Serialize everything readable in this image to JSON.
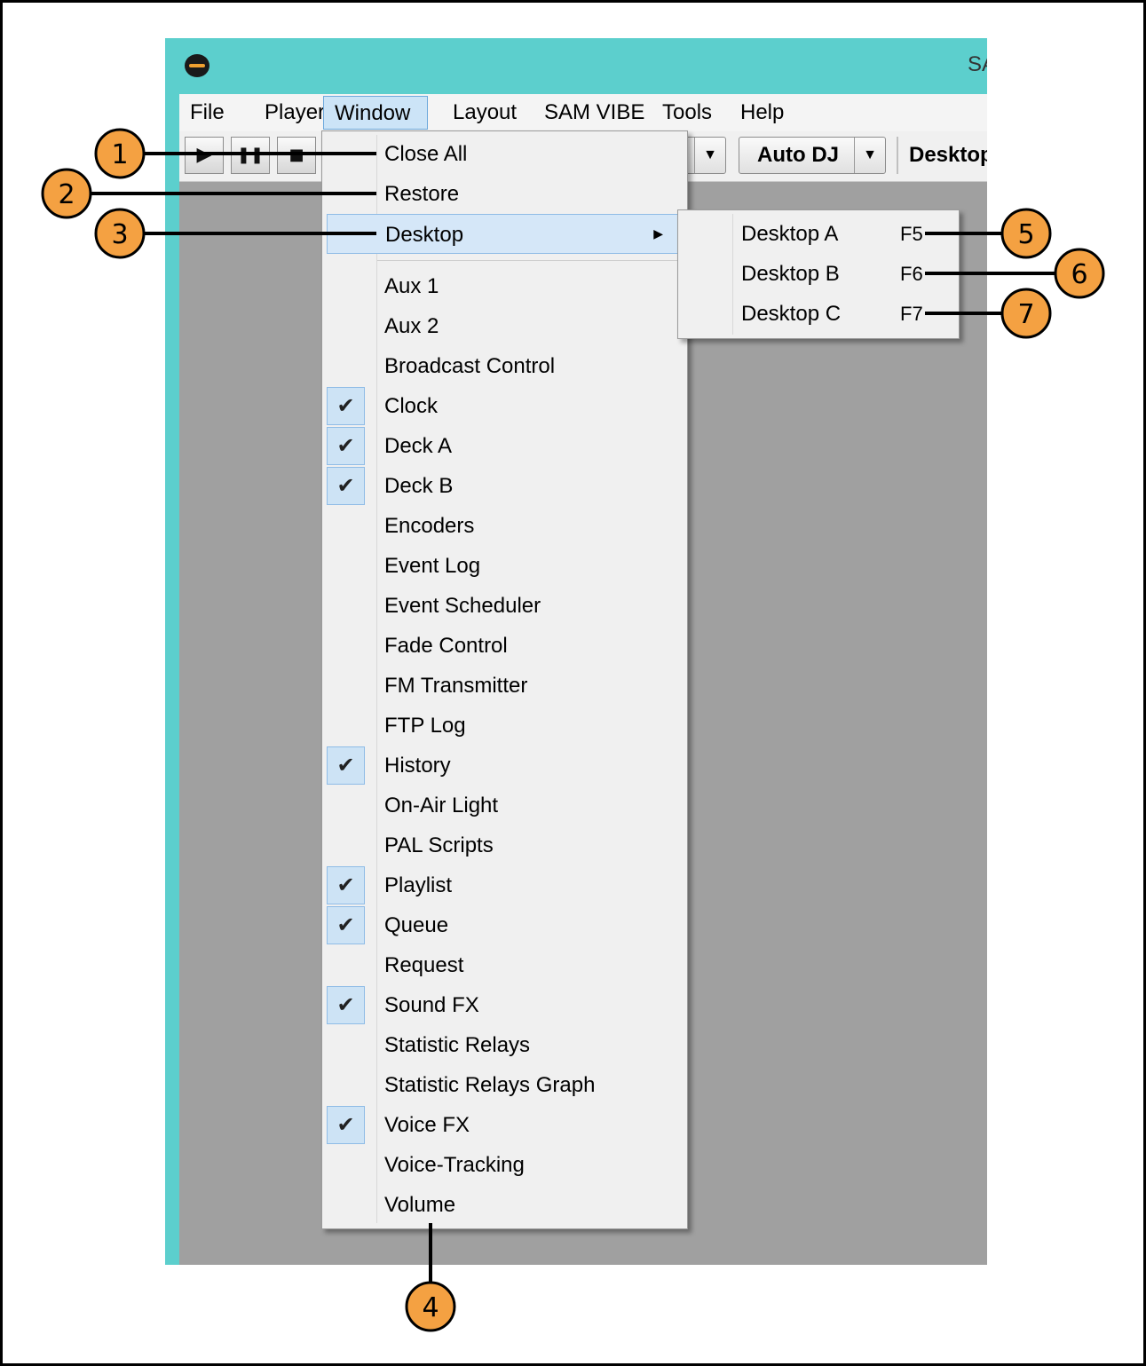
{
  "app": {
    "title": "SA"
  },
  "menubar": {
    "items": [
      "File",
      "Player",
      "Window",
      "Layout",
      "SAM VIBE",
      "Tools",
      "Help"
    ],
    "active": "Window"
  },
  "toolbar": {
    "play_icon": "▶",
    "pause_icon": "❚❚",
    "stop_icon": "■",
    "arrow_icon": "▼",
    "autodj_label": "Auto DJ",
    "desktop_label": "Desktop"
  },
  "window_menu": {
    "top_items": [
      "Close All",
      "Restore",
      "Desktop"
    ],
    "items": [
      {
        "label": "Aux 1",
        "checked": false
      },
      {
        "label": "Aux 2",
        "checked": false
      },
      {
        "label": "Broadcast Control",
        "checked": false
      },
      {
        "label": "Clock",
        "checked": true
      },
      {
        "label": "Deck A",
        "checked": true
      },
      {
        "label": "Deck B",
        "checked": true
      },
      {
        "label": "Encoders",
        "checked": false
      },
      {
        "label": "Event Log",
        "checked": false
      },
      {
        "label": "Event Scheduler",
        "checked": false
      },
      {
        "label": "Fade Control",
        "checked": false
      },
      {
        "label": "FM Transmitter",
        "checked": false
      },
      {
        "label": "FTP Log",
        "checked": false
      },
      {
        "label": "History",
        "checked": true
      },
      {
        "label": "On-Air Light",
        "checked": false
      },
      {
        "label": "PAL Scripts",
        "checked": false
      },
      {
        "label": "Playlist",
        "checked": true
      },
      {
        "label": "Queue",
        "checked": true
      },
      {
        "label": "Request",
        "checked": false
      },
      {
        "label": "Sound FX",
        "checked": true
      },
      {
        "label": "Statistic Relays",
        "checked": false
      },
      {
        "label": "Statistic Relays Graph",
        "checked": false
      },
      {
        "label": "Voice FX",
        "checked": true
      },
      {
        "label": "Voice-Tracking",
        "checked": false
      },
      {
        "label": "Volume",
        "checked": false
      }
    ]
  },
  "desktop_submenu": {
    "items": [
      {
        "label": "Desktop A",
        "key": "F5"
      },
      {
        "label": "Desktop B",
        "key": "F6"
      },
      {
        "label": "Desktop C",
        "key": "F7"
      }
    ]
  },
  "callouts": [
    "1",
    "2",
    "3",
    "4",
    "5",
    "6",
    "7"
  ],
  "colors": {
    "titlebar": "#5ccfcd",
    "callout_fill": "#f4a142",
    "highlight": "#d5e7f8",
    "workspace": "#a0a0a0"
  }
}
